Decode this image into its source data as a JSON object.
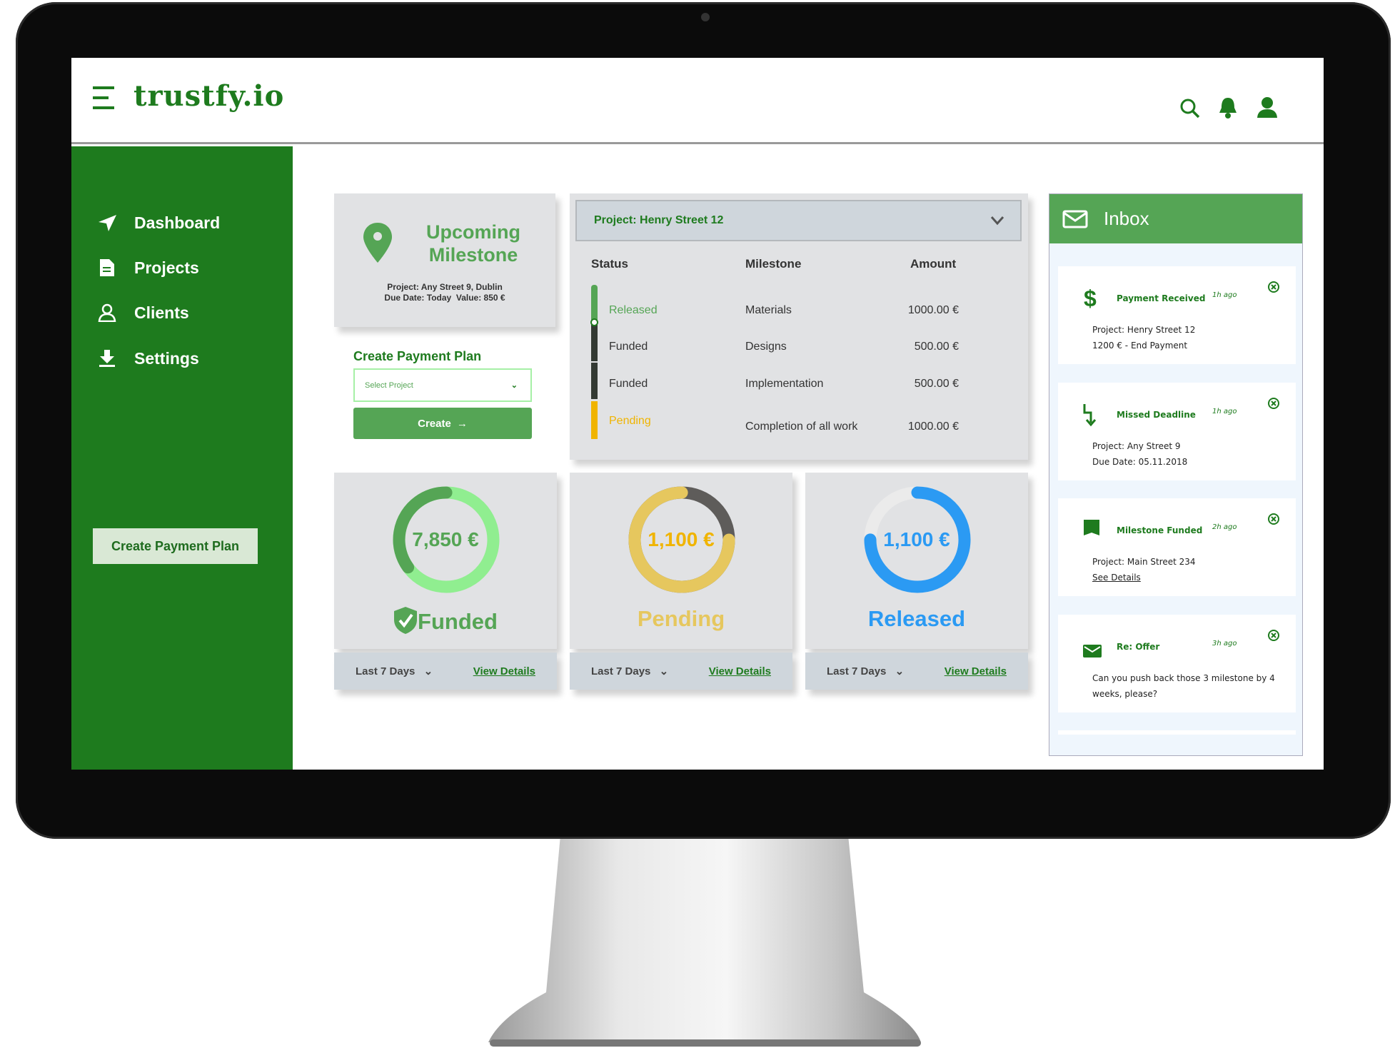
{
  "app": {
    "logo": "trustfy.io"
  },
  "header": {
    "icons": [
      "search-icon",
      "bell-icon",
      "user-icon"
    ]
  },
  "sidebar": {
    "items": [
      {
        "label": "Dashboard",
        "icon": "send-icon"
      },
      {
        "label": "Projects",
        "icon": "document-icon"
      },
      {
        "label": "Clients",
        "icon": "user-icon"
      },
      {
        "label": "Settings",
        "icon": "download-icon"
      }
    ],
    "create_button": "Create Payment Plan"
  },
  "upcoming": {
    "title_line1": "Upcoming",
    "title_line2": "Milestone",
    "project": "Project: Any Street 9, Dublin",
    "due": "Due Date: Today  Value: 850 €"
  },
  "create_plan": {
    "title": "Create Payment Plan",
    "select_placeholder": "Select Project",
    "button": "Create"
  },
  "project_table": {
    "selected_project": "Project: Henry Street 12",
    "headers": [
      "Status",
      "Milestone",
      "Amount"
    ],
    "rows": [
      {
        "status": "Released",
        "milestone": "Materials",
        "amount": "1000.00 €"
      },
      {
        "status": "Funded",
        "milestone": "Designs",
        "amount": "500.00 €"
      },
      {
        "status": "Funded",
        "milestone": "Implementation",
        "amount": "500.00 €"
      },
      {
        "status": "Pending",
        "milestone": "Completion of all work",
        "amount": "1000.00 €"
      }
    ]
  },
  "stats": [
    {
      "value": "7,850 €",
      "label": "Funded",
      "period": "Last 7 Days",
      "link": "View Details",
      "fraction": 0.35,
      "color": "#55a555",
      "track": "#90ee90",
      "text_color": "#55a555"
    },
    {
      "value": "1,100 €",
      "label": "Pending",
      "period": "Last 7 Days",
      "link": "View Details",
      "fraction": 0.75,
      "color": "#e6c75e",
      "track": "#5e5c5a",
      "text_color": "#f0b400"
    },
    {
      "value": "1,100 €",
      "label": "Released",
      "period": "Last 7 Days",
      "link": "View Details",
      "fraction": 0.75,
      "color": "#2b9af3",
      "track": "#ebebeb",
      "text_color": "#2b9af3"
    }
  ],
  "inbox": {
    "title": "Inbox",
    "messages": [
      {
        "title": "Payment Received",
        "ago": "1h ago",
        "line1": "Project: Henry Street 12",
        "line2": "1200 € - End Payment",
        "icon": "dollar-icon"
      },
      {
        "title": "Missed Deadline",
        "ago": "1h ago",
        "line1": "Project: Any Street 9",
        "line2": "Due Date: 05.11.2018",
        "icon": "arrow-down-icon"
      },
      {
        "title": "Milestone Funded",
        "ago": "2h ago",
        "line1": "Project: Main Street 234",
        "line2": "See Details",
        "icon": "bookmark-icon"
      },
      {
        "title": "Re: Offer",
        "ago": "3h ago",
        "line1": "Can you push back those 3 milestone by 4 weeks, please?",
        "icon": "envelope-icon"
      }
    ]
  },
  "colors": {
    "brand": "#1e7b1e",
    "accent": "#55a555",
    "pending": "#f0b400",
    "released": "#2b9af3"
  }
}
